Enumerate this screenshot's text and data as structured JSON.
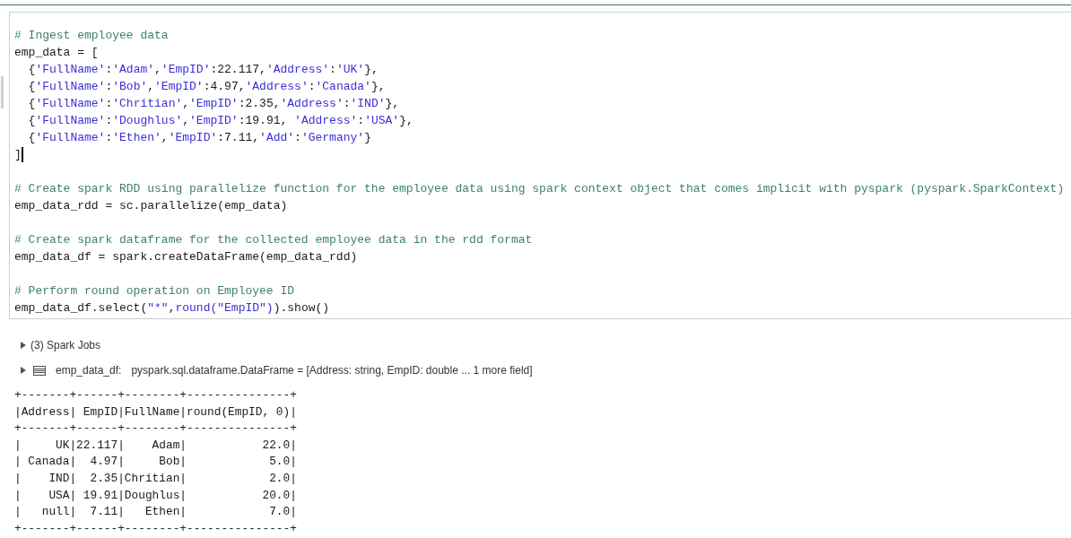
{
  "cell": {
    "blocks": [
      {
        "lines": [
          [
            {
              "kind": "comment",
              "text": "# Ingest employee data"
            }
          ],
          [
            {
              "kind": "plain",
              "text": "emp_data = ["
            }
          ],
          [
            {
              "kind": "plain",
              "text": "  {"
            },
            {
              "kind": "string",
              "text": "'FullName'"
            },
            {
              "kind": "plain",
              "text": ":"
            },
            {
              "kind": "string",
              "text": "'Adam'"
            },
            {
              "kind": "plain",
              "text": ","
            },
            {
              "kind": "string",
              "text": "'EmpID'"
            },
            {
              "kind": "plain",
              "text": ":22.117,"
            },
            {
              "kind": "string",
              "text": "'Address'"
            },
            {
              "kind": "plain",
              "text": ":"
            },
            {
              "kind": "string",
              "text": "'UK'"
            },
            {
              "kind": "plain",
              "text": "},"
            }
          ],
          [
            {
              "kind": "plain",
              "text": "  {"
            },
            {
              "kind": "string",
              "text": "'FullName'"
            },
            {
              "kind": "plain",
              "text": ":"
            },
            {
              "kind": "string",
              "text": "'Bob'"
            },
            {
              "kind": "plain",
              "text": ","
            },
            {
              "kind": "string",
              "text": "'EmpID'"
            },
            {
              "kind": "plain",
              "text": ":4.97,"
            },
            {
              "kind": "string",
              "text": "'Address'"
            },
            {
              "kind": "plain",
              "text": ":"
            },
            {
              "kind": "string",
              "text": "'Canada'"
            },
            {
              "kind": "plain",
              "text": "},"
            }
          ],
          [
            {
              "kind": "plain",
              "text": "  {"
            },
            {
              "kind": "string",
              "text": "'FullName'"
            },
            {
              "kind": "plain",
              "text": ":"
            },
            {
              "kind": "string",
              "text": "'Chritian'"
            },
            {
              "kind": "plain",
              "text": ","
            },
            {
              "kind": "string",
              "text": "'EmpID'"
            },
            {
              "kind": "plain",
              "text": ":2.35,"
            },
            {
              "kind": "string",
              "text": "'Address'"
            },
            {
              "kind": "plain",
              "text": ":"
            },
            {
              "kind": "string",
              "text": "'IND'"
            },
            {
              "kind": "plain",
              "text": "},"
            }
          ],
          [
            {
              "kind": "plain",
              "text": "  {"
            },
            {
              "kind": "string",
              "text": "'FullName'"
            },
            {
              "kind": "plain",
              "text": ":"
            },
            {
              "kind": "string",
              "text": "'Doughlus'"
            },
            {
              "kind": "plain",
              "text": ","
            },
            {
              "kind": "string",
              "text": "'EmpID'"
            },
            {
              "kind": "plain",
              "text": ":19.91, "
            },
            {
              "kind": "string",
              "text": "'Address'"
            },
            {
              "kind": "plain",
              "text": ":"
            },
            {
              "kind": "string",
              "text": "'USA'"
            },
            {
              "kind": "plain",
              "text": "},"
            }
          ],
          [
            {
              "kind": "plain",
              "text": "  {"
            },
            {
              "kind": "string",
              "text": "'FullName'"
            },
            {
              "kind": "plain",
              "text": ":"
            },
            {
              "kind": "string",
              "text": "'Ethen'"
            },
            {
              "kind": "plain",
              "text": ","
            },
            {
              "kind": "string",
              "text": "'EmpID'"
            },
            {
              "kind": "plain",
              "text": ":7.11,"
            },
            {
              "kind": "string",
              "text": "'Add'"
            },
            {
              "kind": "plain",
              "text": ":"
            },
            {
              "kind": "string",
              "text": "'Germany'"
            },
            {
              "kind": "plain",
              "text": "}"
            }
          ],
          [
            {
              "kind": "plain",
              "text": "]"
            }
          ]
        ],
        "cursor": true
      },
      {
        "lines": [
          [
            {
              "kind": "comment",
              "text": "# Create spark RDD using parallelize function for the employee data using spark context object that comes implicit with pyspark (pyspark.SparkContext)"
            }
          ],
          [
            {
              "kind": "plain",
              "text": "emp_data_rdd = sc.parallelize(emp_data)"
            }
          ]
        ],
        "cursor": false
      },
      {
        "lines": [
          [
            {
              "kind": "comment",
              "text": "# Create spark dataframe for the collected employee data in the rdd format"
            }
          ],
          [
            {
              "kind": "plain",
              "text": "emp_data_df = spark.createDataFrame(emp_data_rdd)"
            }
          ]
        ],
        "cursor": false
      },
      {
        "lines": [
          [
            {
              "kind": "comment",
              "text": "# Perform round operation on Employee ID"
            }
          ],
          [
            {
              "kind": "plain",
              "text": "emp_data_df.select("
            },
            {
              "kind": "string",
              "text": "\"*\""
            },
            {
              "kind": "plain",
              "text": ","
            },
            {
              "kind": "string",
              "text": "round(\"EmpID\")"
            },
            {
              "kind": "plain",
              "text": ").show()"
            }
          ]
        ],
        "cursor": false
      }
    ]
  },
  "output": {
    "spark_jobs": {
      "label": "(3) Spark Jobs",
      "expanded": false
    },
    "dataframe": {
      "name": "emp_data_df:",
      "type": "pyspark.sql.dataframe.DataFrame = [Address: string, EmpID: double ... 1 more field]",
      "expanded": false
    },
    "lines": [
      "+-------+------+--------+---------------+",
      "|Address| EmpID|FullName|round(EmpID, 0)|",
      "+-------+------+--------+---------------+",
      "|     UK|22.117|    Adam|           22.0|",
      "| Canada|  4.97|     Bob|            5.0|",
      "|    IND|  2.35|Chritian|            2.0|",
      "|    USA| 19.91|Doughlus|           20.0|",
      "|   null|  7.11|   Ethen|            7.0|",
      "+-------+------+--------+---------------+"
    ]
  }
}
